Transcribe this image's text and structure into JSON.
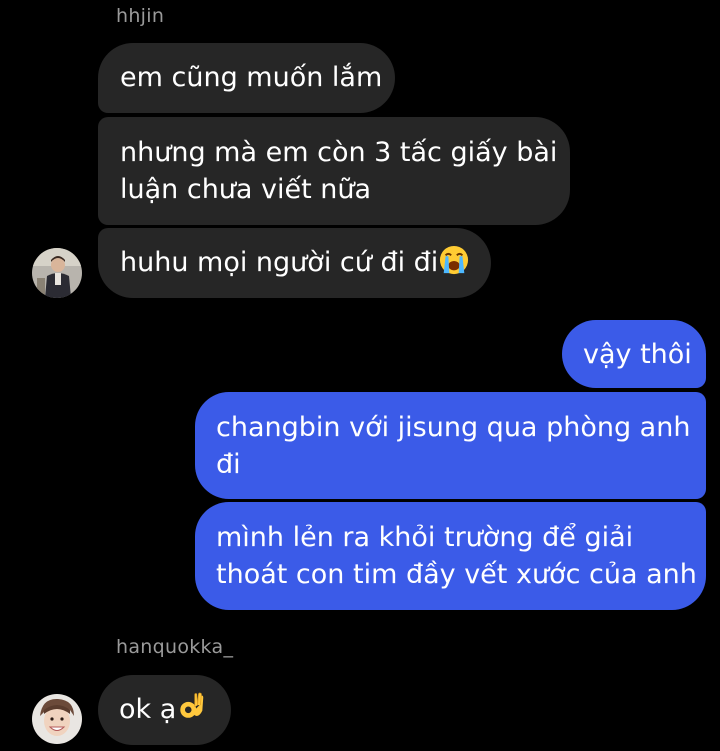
{
  "thread": {
    "messages": [
      {
        "sender": "hhjin",
        "text": "em cũng muốn lắm"
      },
      {
        "text_line1": "nhưng mà em còn 3 tấc giấy bài",
        "text_line2": "luận chưa viết nữa"
      },
      {
        "text": "huhu mọi người cứ đi đi",
        "emoji": "loudly-crying-face-icon"
      },
      {
        "text": "vậy thôi"
      },
      {
        "text_line1": "changbin với jisung qua phòng anh",
        "text_line2": "đi"
      },
      {
        "text_line1": "mình lẻn ra khỏi trường để giải",
        "text_line2": "thoát con tim đầy vết xước của anh"
      },
      {
        "sender": "hanquokka_",
        "text": "ok ạ",
        "emoji": "ok-hand-icon"
      }
    ]
  },
  "colors": {
    "background": "#000000",
    "incoming_bubble": "#262626",
    "outgoing_bubble": "#3b5be8",
    "sender_name": "#9a9a9a"
  }
}
